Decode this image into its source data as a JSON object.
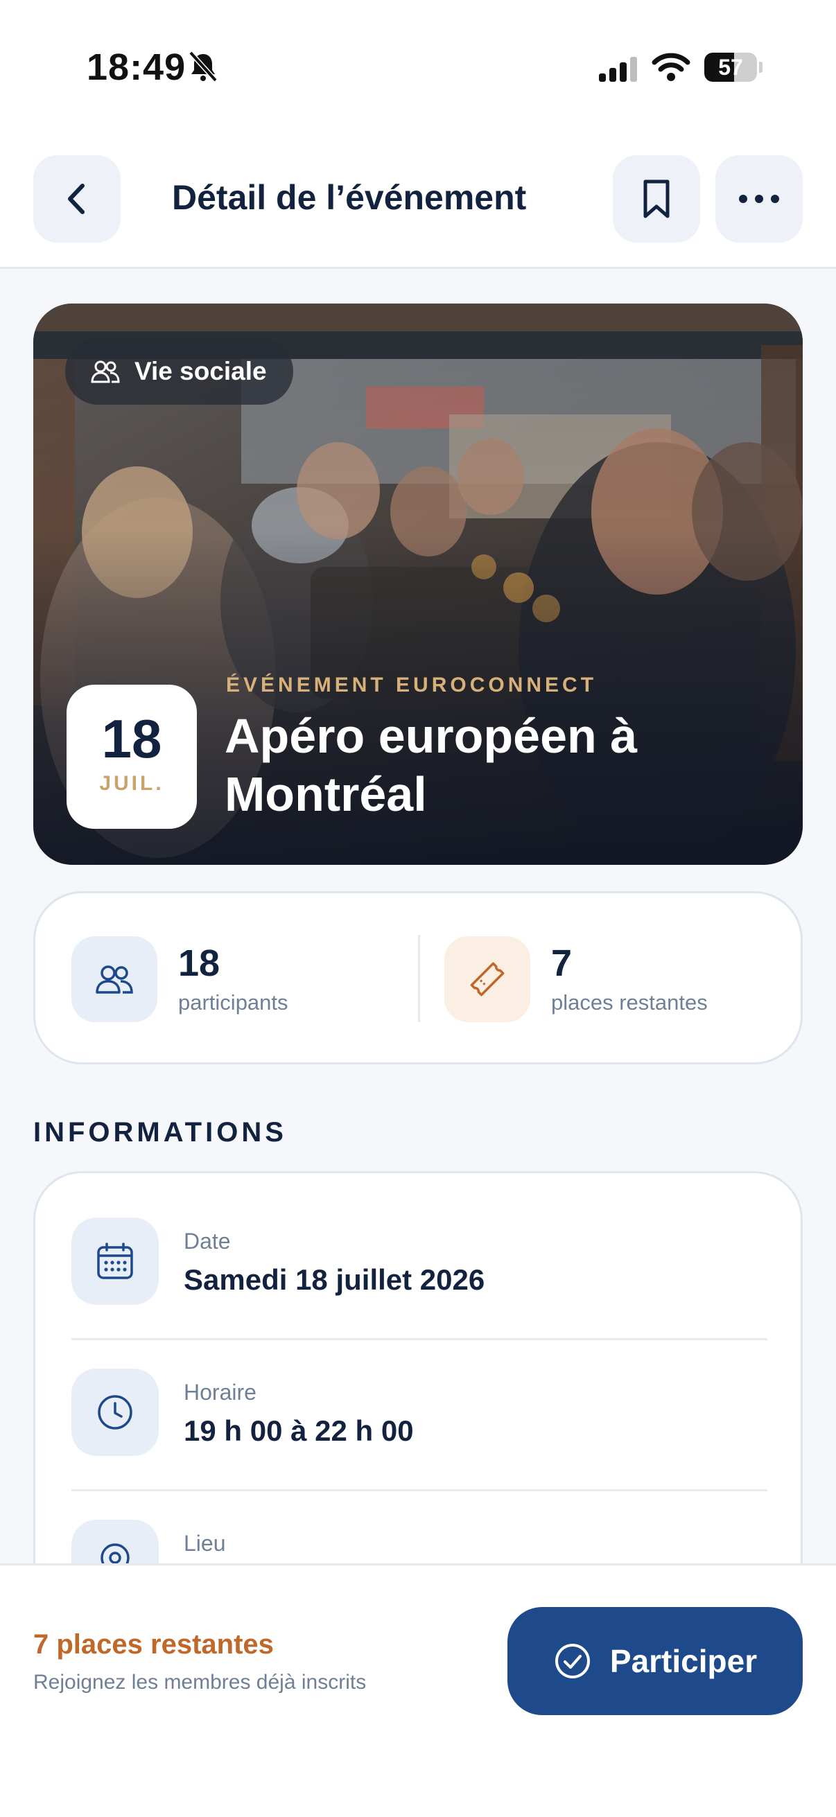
{
  "status_bar": {
    "time": "18:49",
    "battery": "57",
    "battery_level": 0.57
  },
  "header": {
    "title": "Détail de l’événement",
    "back_icon": "chevron-left-icon",
    "bookmark_icon": "bookmark-icon",
    "more_icon": "ellipsis-icon"
  },
  "hero": {
    "category": "Vie sociale",
    "category_icon": "people-icon",
    "date_day": "18",
    "date_month": "JUIL.",
    "kicker": "ÉVÉNEMENT EUROCONNECT",
    "title": "Apéro européen à Montréal"
  },
  "stats": {
    "participants_count": "18",
    "participants_label": "participants",
    "places_count": "7",
    "places_label": "places restantes"
  },
  "informations": {
    "heading": "INFORMATIONS",
    "rows": [
      {
        "label": "Date",
        "value": "Samedi 18 juillet 2026",
        "icon": "calendar-icon"
      },
      {
        "label": "Horaire",
        "value": "19 h 00 à 22 h 00",
        "icon": "clock-icon"
      },
      {
        "label": "Lieu",
        "value": "",
        "icon": "location-pin-icon"
      }
    ]
  },
  "bottom_bar": {
    "remaining": "7 places restantes",
    "subtitle": "Rejoignez les membres déjà inscrits",
    "cta": "Participer",
    "cta_icon": "check-circle-icon"
  },
  "colors": {
    "primary": "#1e4a8b",
    "accent_orange": "#c0672a",
    "gold": "#c9a36b",
    "navy_text": "#13233f",
    "muted_text": "#6f7f95",
    "background": "#f5f7fb"
  }
}
